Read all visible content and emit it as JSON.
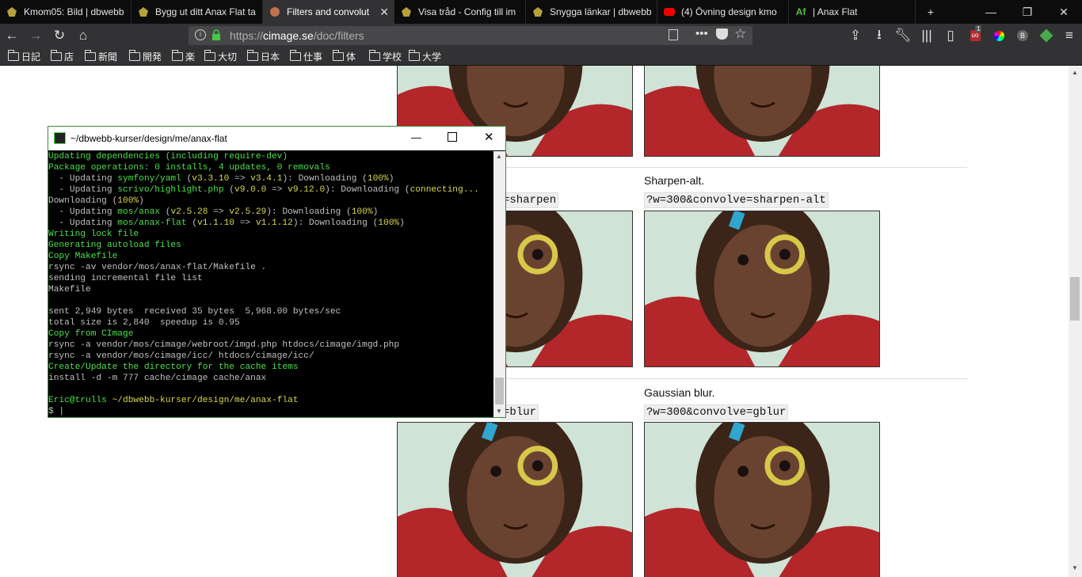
{
  "tabs": [
    {
      "title": "Kmom05: Bild | dbwebb",
      "icon": "dbwebb-icon"
    },
    {
      "title": "Bygg ut ditt Anax Flat ta",
      "icon": "dbwebb-icon"
    },
    {
      "title": "Filters and convolut",
      "icon": "cimage-icon",
      "active": true
    },
    {
      "title": "Visa tråd - Config till im",
      "icon": "dbwebb-icon"
    },
    {
      "title": "Snygga länkar | dbwebb",
      "icon": "dbwebb-icon"
    },
    {
      "title": "(4) Övning design kmo",
      "icon": "youtube-icon"
    },
    {
      "title": "| Anax Flat",
      "icon": "anax-icon"
    }
  ],
  "tabbar": {
    "new_tab": "+",
    "minimize": "—",
    "restore": "❐",
    "close": "✕"
  },
  "nav": {
    "url_prefix": "https://",
    "url_host": "cimage.se",
    "url_path": "/doc/filters",
    "badge_count": "1"
  },
  "bookmarks": [
    "日記",
    "店",
    "新聞",
    "開発",
    "楽",
    "大切",
    "日本",
    "仕事",
    "体",
    "学校",
    "大学"
  ],
  "page": {
    "sections": [
      {
        "caption": "",
        "left_code": "",
        "right_code": ""
      },
      {
        "caption": "Sharpen-alt.",
        "left_code": "=sharpen",
        "right_code": "?w=300&convolve=sharpen-alt"
      },
      {
        "caption": "Gaussian blur.",
        "left_code": "=blur",
        "right_code": "?w=300&convolve=gblur"
      }
    ]
  },
  "terminal": {
    "title": "~/dbwebb-kurser/design/me/anax-flat",
    "lines": [
      [
        [
          "g",
          "Updating dependencies (including require-dev)"
        ]
      ],
      [
        [
          "g",
          "Package operations: 0 installs, 4 updates, 0 removals"
        ]
      ],
      [
        [
          "w",
          "  - Updating "
        ],
        [
          "g",
          "symfony/yaml"
        ],
        [
          "w",
          " ("
        ],
        [
          "y",
          "v3.3.10"
        ],
        [
          "w",
          " => "
        ],
        [
          "y",
          "v3.4.1"
        ],
        [
          "w",
          "): Downloading ("
        ],
        [
          "y",
          "100%"
        ],
        [
          "w",
          ")"
        ]
      ],
      [
        [
          "w",
          "  - Updating "
        ],
        [
          "g",
          "scrivo/highlight.php"
        ],
        [
          "w",
          " ("
        ],
        [
          "y",
          "v9.0.0"
        ],
        [
          "w",
          " => "
        ],
        [
          "y",
          "v9.12.0"
        ],
        [
          "w",
          "): Downloading ("
        ],
        [
          "y",
          "connecting..."
        ]
      ],
      [
        [
          "w",
          "Downloading ("
        ],
        [
          "y",
          "100%"
        ],
        [
          "w",
          ")"
        ]
      ],
      [
        [
          "w",
          "  - Updating "
        ],
        [
          "g",
          "mos/anax"
        ],
        [
          "w",
          " ("
        ],
        [
          "y",
          "v2.5.28"
        ],
        [
          "w",
          " => "
        ],
        [
          "y",
          "v2.5.29"
        ],
        [
          "w",
          "): Downloading ("
        ],
        [
          "y",
          "100%"
        ],
        [
          "w",
          ")"
        ]
      ],
      [
        [
          "w",
          "  - Updating "
        ],
        [
          "g",
          "mos/anax-flat"
        ],
        [
          "w",
          " ("
        ],
        [
          "y",
          "v1.1.10"
        ],
        [
          "w",
          " => "
        ],
        [
          "y",
          "v1.1.12"
        ],
        [
          "w",
          "): Downloading ("
        ],
        [
          "y",
          "100%"
        ],
        [
          "w",
          ")"
        ]
      ],
      [
        [
          "g",
          "Writing lock file"
        ]
      ],
      [
        [
          "g",
          "Generating autoload files"
        ]
      ],
      [
        [
          "g",
          "Copy Makefile"
        ]
      ],
      [
        [
          "w",
          "rsync -av vendor/mos/anax-flat/Makefile ."
        ]
      ],
      [
        [
          "w",
          "sending incremental file list"
        ]
      ],
      [
        [
          "w",
          "Makefile"
        ]
      ],
      [
        [
          "w",
          ""
        ]
      ],
      [
        [
          "w",
          "sent 2,949 bytes  received 35 bytes  5,968.00 bytes/sec"
        ]
      ],
      [
        [
          "w",
          "total size is 2,840  speedup is 0.95"
        ]
      ],
      [
        [
          "g",
          "Copy from CImage"
        ]
      ],
      [
        [
          "w",
          "rsync -a vendor/mos/cimage/webroot/imgd.php htdocs/cimage/imgd.php"
        ]
      ],
      [
        [
          "w",
          "rsync -a vendor/mos/cimage/icc/ htdocs/cimage/icc/"
        ]
      ],
      [
        [
          "g",
          "Create/Update the directory for the cache items"
        ]
      ],
      [
        [
          "w",
          "install -d -m 777 cache/cimage cache/anax"
        ]
      ],
      [
        [
          "w",
          ""
        ]
      ],
      [
        [
          "g",
          "Eric@trulls"
        ],
        [
          "w",
          " "
        ],
        [
          "y",
          "~/dbwebb-kurser/design/me/anax-flat"
        ]
      ],
      [
        [
          "w",
          "$ |"
        ]
      ]
    ]
  }
}
